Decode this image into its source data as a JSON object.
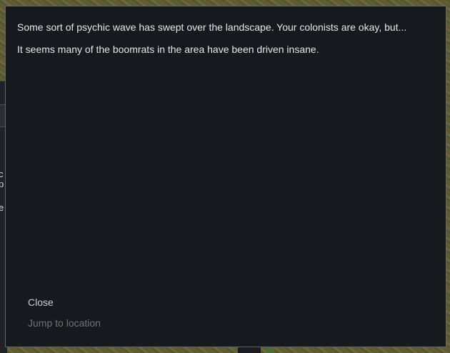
{
  "dialog": {
    "message_lines": [
      "Some sort of psychic wave has swept over the landscape. Your colonists are okay, but...",
      "It seems many of the boomrats in the area have been driven insane."
    ],
    "options": [
      {
        "label": "Close",
        "enabled": true
      },
      {
        "label": "Jump to location",
        "enabled": false
      }
    ]
  },
  "background_panel": {
    "fragments": [
      "c",
      "p",
      "e"
    ]
  },
  "colors": {
    "dialog_bg": "#16191d",
    "dialog_border": "#5f6670",
    "text": "#e6e6e6",
    "option_enabled": "#c9ced6",
    "option_disabled": "#6e737a"
  }
}
